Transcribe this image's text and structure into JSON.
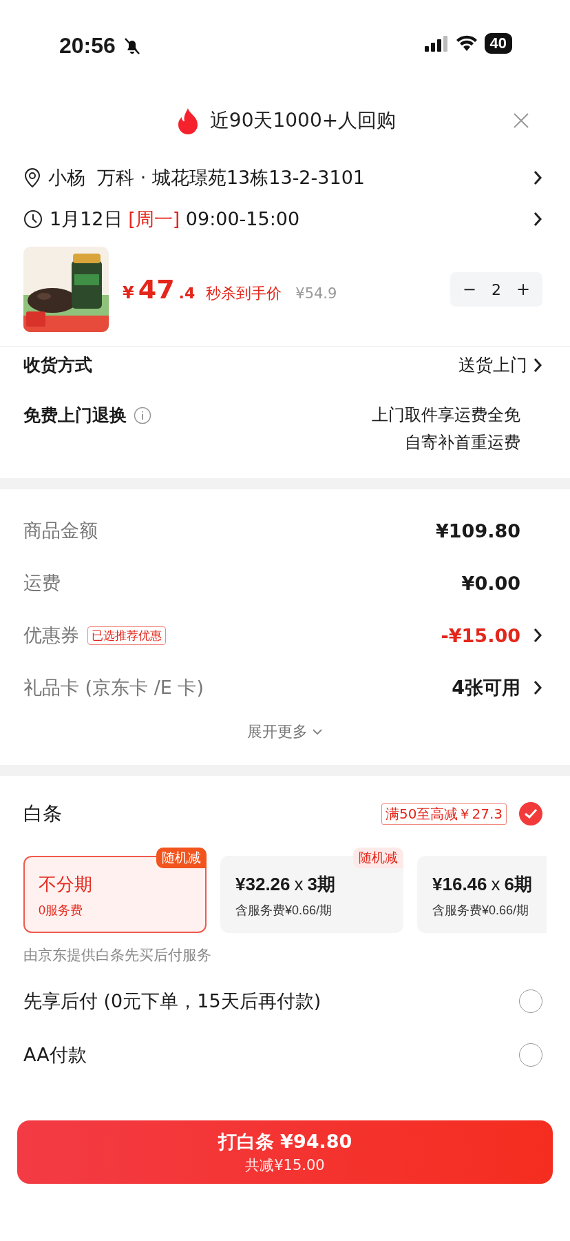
{
  "status_bar": {
    "time": "20:56",
    "battery": "40"
  },
  "header": {
    "title": "近90天1000+人回购"
  },
  "address": {
    "text": "小杨  万科 · 城花璟苑13栋13-2-3101"
  },
  "delivery_time": {
    "date": "1月12日",
    "weekday": "[周一]",
    "window": "09:00-15:00"
  },
  "product": {
    "currency": "¥",
    "price_int": "47",
    "price_dec": ".4",
    "price_label": "秒杀到手价",
    "original_price": "¥54.9",
    "quantity": "2",
    "minus": "−",
    "plus": "+"
  },
  "shipping": {
    "label": "收货方式",
    "value": "送货上门"
  },
  "returns": {
    "label": "免费上门退换",
    "lines": [
      "上门取件享运费全免",
      "自寄补首重运费"
    ]
  },
  "amounts": [
    {
      "label": "商品金额",
      "value": "¥109.80",
      "kind": "plain"
    },
    {
      "label": "运费",
      "value": "¥0.00",
      "kind": "plain"
    },
    {
      "label": "优惠券",
      "tag": "已选推荐优惠",
      "value": "-¥15.00",
      "kind": "discount",
      "chevron": true
    },
    {
      "label": "礼品卡 (京东卡 /E 卡)",
      "value": "4张可用",
      "kind": "plain",
      "chevron": true
    }
  ],
  "expand": {
    "label": "展开更多"
  },
  "baitiao": {
    "title": "白条",
    "promo": "满50至高减￥27.3",
    "checked": true
  },
  "plans": [
    {
      "kind": "full",
      "title": "不分期",
      "subtitle": "0服务费",
      "badge": "随机减",
      "selected": true
    },
    {
      "kind": "installment",
      "amount": "¥32.26",
      "times": "x",
      "periods": "3期",
      "subtitle": "含服务费¥0.66/期",
      "badge": "随机减",
      "selected": false
    },
    {
      "kind": "installment",
      "amount": "¥16.46",
      "times": "x",
      "periods": "6期",
      "subtitle": "含服务费¥0.66/期",
      "selected": false
    }
  ],
  "note": "由京东提供白条先买后付服务",
  "pay_options": [
    {
      "label": "先享后付 (0元下单，15天后再付款)",
      "selected": false
    },
    {
      "label": "AA付款",
      "selected": false
    }
  ],
  "footer": {
    "title": "打白条 ¥94.80",
    "subtitle": "共减¥15.00"
  }
}
